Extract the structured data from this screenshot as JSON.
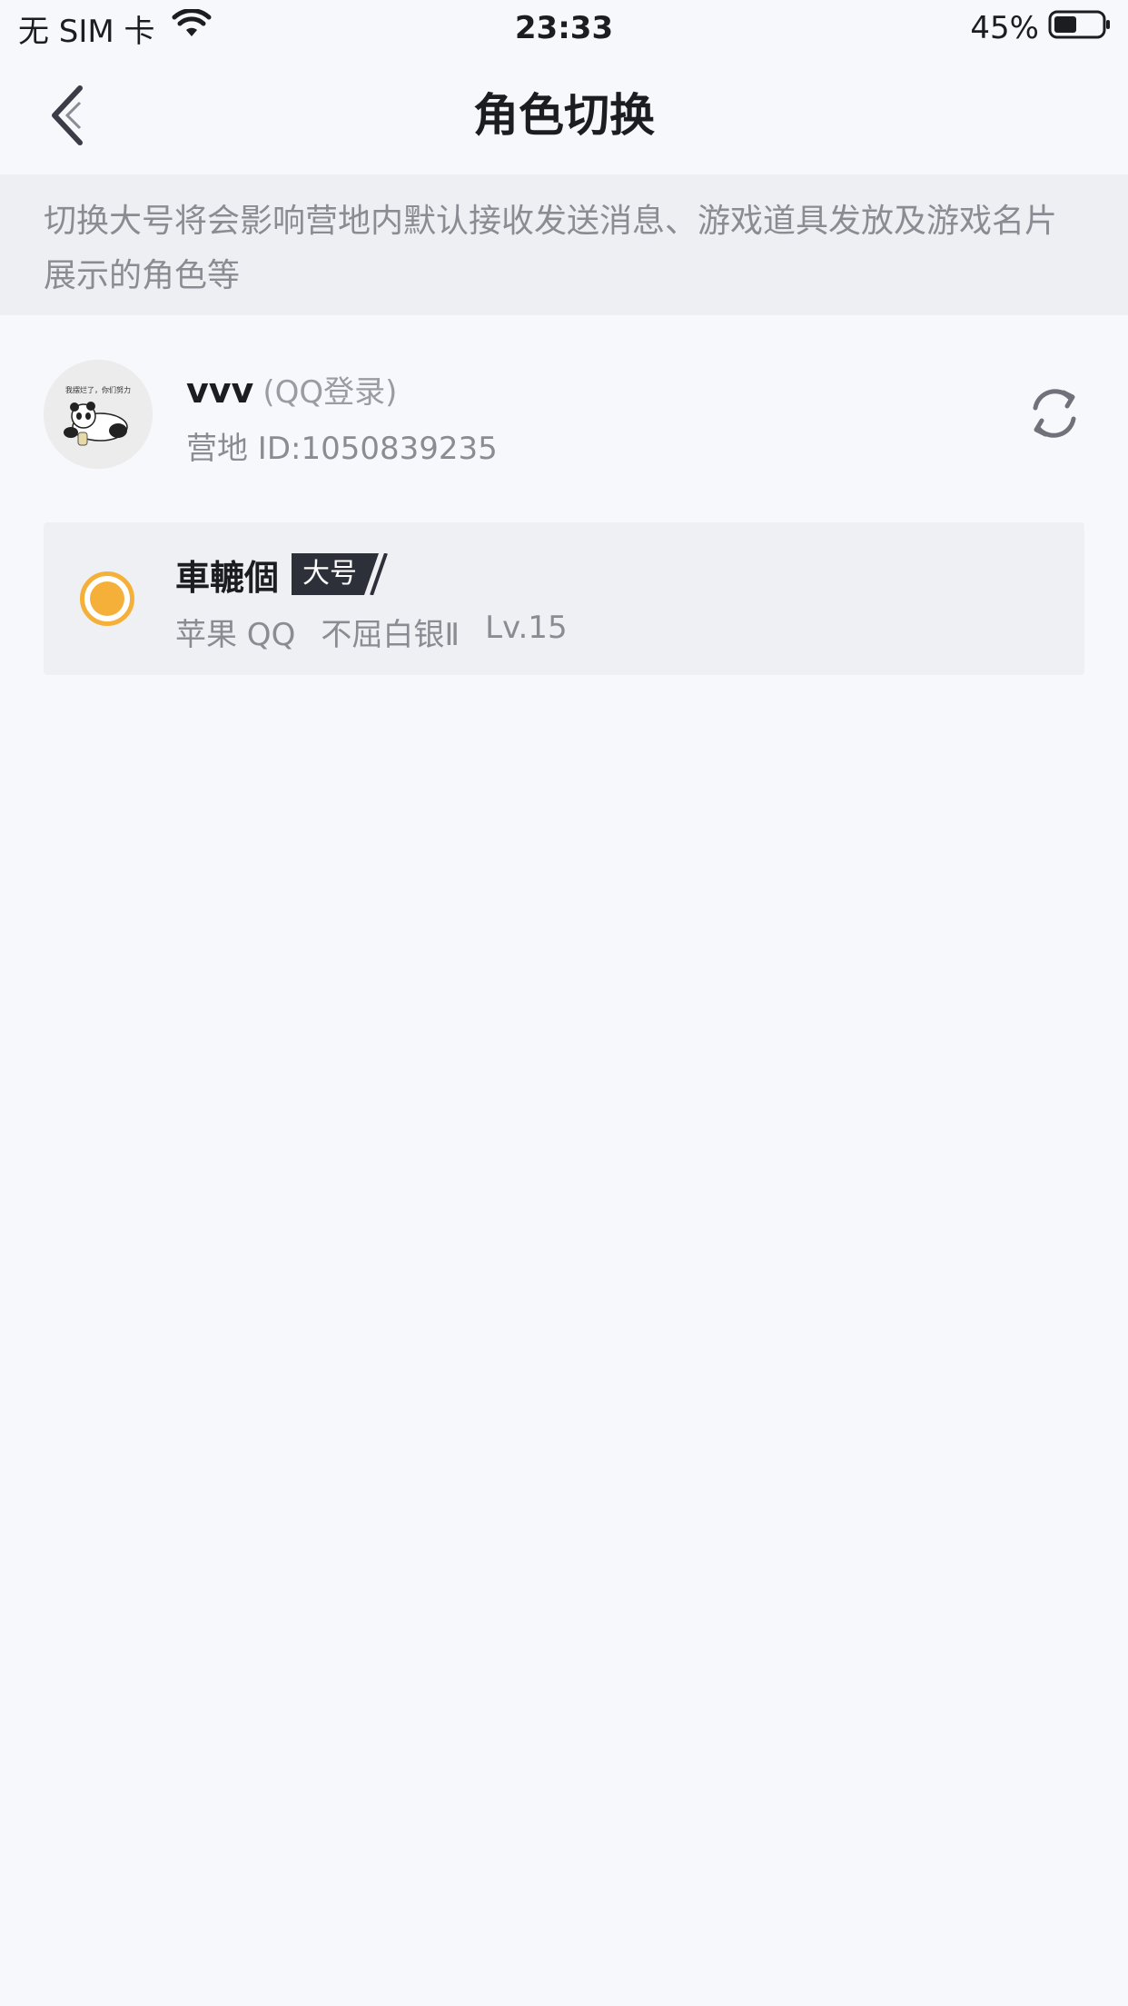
{
  "status_bar": {
    "carrier": "无 SIM 卡",
    "time": "23:33",
    "battery": "45%"
  },
  "nav": {
    "title": "角色切换"
  },
  "notice": {
    "text": "切换大号将会影响营地内默认接收发送消息、游戏道具发放及游戏名片展示的角色等"
  },
  "account": {
    "name": "vvv",
    "login_method": "(QQ登录)",
    "camp_id": "营地 ID:1050839235",
    "avatar_caption": "我摆烂了，你们努力"
  },
  "role": {
    "name": "車轆個",
    "badge": "大号",
    "platform": "苹果 QQ",
    "rank": "不屈白银Ⅱ",
    "level": "Lv.15",
    "selected": true
  },
  "colors": {
    "accent": "#f5b03a",
    "badge_bg": "#2d3039",
    "background": "#f7f8fb",
    "notice_bg": "#eeeff2"
  },
  "icons": {
    "back": "chevron-left-icon",
    "refresh": "refresh-icon",
    "wifi": "wifi-icon",
    "battery": "battery-icon"
  }
}
